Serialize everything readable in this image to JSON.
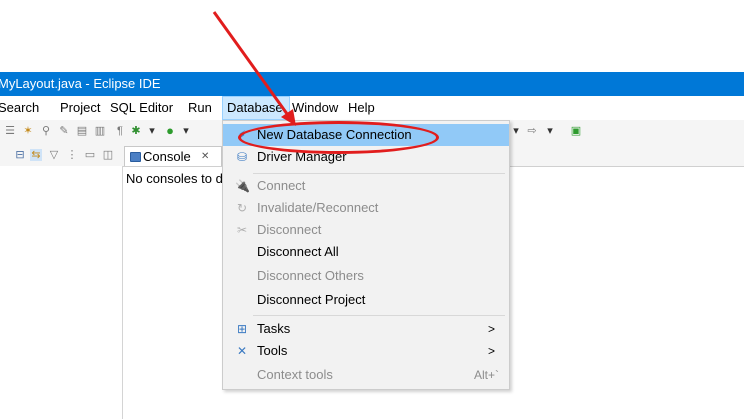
{
  "window": {
    "title": "MyLayout.java - Eclipse IDE"
  },
  "menubar": {
    "items": [
      "Search",
      "Project",
      "SQL Editor",
      "Run",
      "Database",
      "Window",
      "Help"
    ]
  },
  "console": {
    "tab_label": "Console",
    "close_glyph": "✕",
    "message": "No consoles to display"
  },
  "database_menu": {
    "items": [
      {
        "label": "New Database Connection",
        "icon": "plug-plus-icon",
        "enabled": true,
        "highlighted": true
      },
      {
        "label": "Driver Manager",
        "icon": "database-icon",
        "enabled": true
      },
      {
        "label": "Connect",
        "icon": "plug-icon",
        "enabled": false
      },
      {
        "label": "Invalidate/Reconnect",
        "icon": "reconnect-icon",
        "enabled": false
      },
      {
        "label": "Disconnect",
        "icon": "unplug-icon",
        "enabled": false
      },
      {
        "label": "Disconnect All",
        "enabled": true
      },
      {
        "label": "Disconnect Others",
        "enabled": false
      },
      {
        "label": "Disconnect Project",
        "enabled": true
      },
      {
        "label": "Tasks",
        "icon": "tasks-icon",
        "enabled": true,
        "submenu": true
      },
      {
        "label": "Tools",
        "icon": "tools-icon",
        "enabled": true,
        "submenu": true
      },
      {
        "label": "Context tools",
        "enabled": false,
        "accelerator": "Alt+`"
      }
    ]
  },
  "annotation": {
    "color": "#e11d1d"
  },
  "colors": {
    "titlebar": "#0078d7",
    "highlight": "#91c9f7",
    "disabled_text": "#8c8c8c"
  }
}
